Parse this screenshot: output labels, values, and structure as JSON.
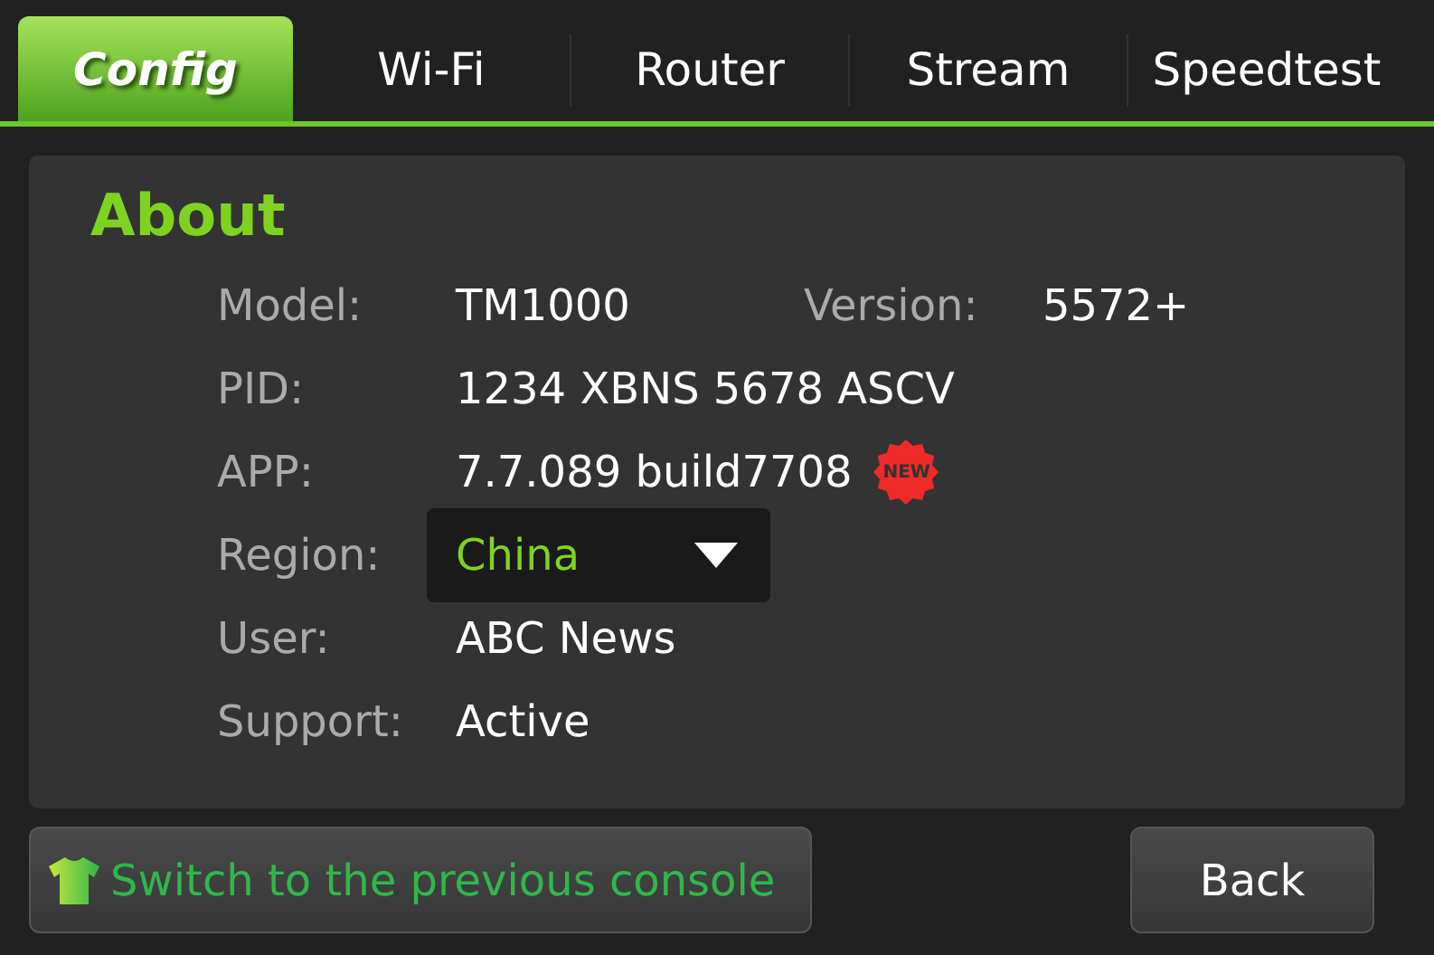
{
  "tabs": [
    {
      "label": "Config",
      "selected": true
    },
    {
      "label": "Wi-Fi",
      "selected": false
    },
    {
      "label": "Router",
      "selected": false
    },
    {
      "label": "Stream",
      "selected": false
    },
    {
      "label": "Speedtest",
      "selected": false
    }
  ],
  "about": {
    "title": "About",
    "rows": [
      {
        "kind": "pair",
        "label": "Model:",
        "value": "TM1000",
        "label_2": "Version:",
        "value_2": "5572+"
      },
      {
        "kind": "text",
        "label": "PID:",
        "value": "1234 XBNS 5678 ASCV"
      },
      {
        "kind": "badge",
        "label": "APP:",
        "value": "7.7.089 build7708",
        "badge": "NEW"
      },
      {
        "kind": "select",
        "label": "Region:",
        "value": "China"
      },
      {
        "kind": "text",
        "label": "User:",
        "value": "ABC News"
      },
      {
        "kind": "text",
        "label": "Support:",
        "value": "Active"
      }
    ]
  },
  "buttons": {
    "switch": "Switch to the previous console",
    "back": "Back"
  }
}
